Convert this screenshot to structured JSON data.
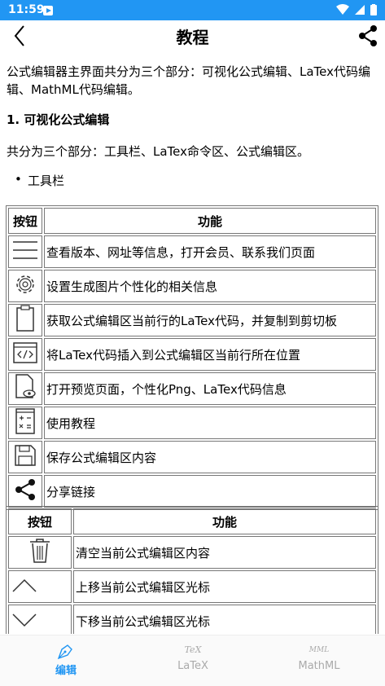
{
  "status_bar": {
    "time": "11:59"
  },
  "app_bar": {
    "title": "教程"
  },
  "intro": "公式编辑器主界面共分为三个部分：可视化公式编辑、LaTex代码编辑、MathML代码编辑。",
  "section1": {
    "heading": "1. 可视化公式编辑",
    "desc": "共分为三个部分：工具栏、LaTex命令区、公式编辑区。",
    "bullet": "工具栏"
  },
  "table1": {
    "headers": [
      "按钮",
      "功能"
    ],
    "rows": [
      {
        "icon": "menu-icon",
        "text": "查看版本、网址等信息，打开会员、联系我们页面"
      },
      {
        "icon": "gear-icon",
        "text": "设置生成图片个性化的相关信息"
      },
      {
        "icon": "clipboard-icon",
        "text": "获取公式编辑区当前行的LaTex代码，并复制到剪切板"
      },
      {
        "icon": "code-icon",
        "text": "将LaTex代码插入到公式编辑区当前行所在位置"
      },
      {
        "icon": "preview-file-icon",
        "text": "打开预览页面，个性化Png、LaTex代码信息"
      },
      {
        "icon": "calculator-icon",
        "text": "使用教程"
      },
      {
        "icon": "save-icon",
        "text": "保存公式编辑区内容"
      },
      {
        "icon": "share-icon",
        "text": "分享链接"
      }
    ]
  },
  "table2": {
    "headers": [
      "按钮",
      "功能"
    ],
    "rows": [
      {
        "icon": "trash-icon",
        "text": "清空当前公式编辑区内容"
      },
      {
        "icon": "chevron-up-icon",
        "text": "上移当前公式编辑区光标"
      },
      {
        "icon": "chevron-down-icon",
        "text": "下移当前公式编辑区光标"
      }
    ]
  },
  "bottom_nav": {
    "items": [
      {
        "label": "编辑",
        "active": true
      },
      {
        "label": "LaTeX",
        "glyph": "TeX",
        "active": false
      },
      {
        "label": "MathML",
        "glyph": "MML",
        "active": false
      }
    ]
  },
  "colors": {
    "primary": "#2196F3",
    "inactive": "#aaaaaa"
  }
}
